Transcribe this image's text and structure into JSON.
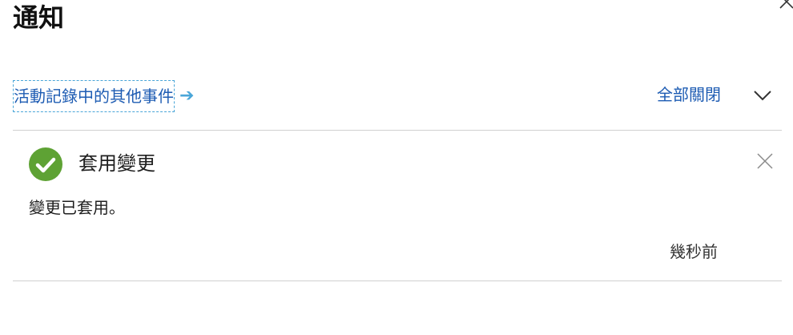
{
  "panel": {
    "title": "通知"
  },
  "toolbar": {
    "activity_link": "活動記錄中的其他事件",
    "activity_arrow": "➔",
    "dismiss_all": "全部關閉"
  },
  "notification": {
    "status": "success",
    "title": "套用變更",
    "message": "變更已套用。",
    "time": "幾秒前"
  },
  "colors": {
    "link": "#1e5cb3",
    "success": "#5ea234",
    "divider": "#d0d0d0",
    "focus_outline": "#4aa6d8"
  },
  "icons": {
    "panel_close": "close-icon",
    "expand": "chevron-down-icon",
    "status": "check-circle-icon",
    "notification_close": "close-icon"
  }
}
